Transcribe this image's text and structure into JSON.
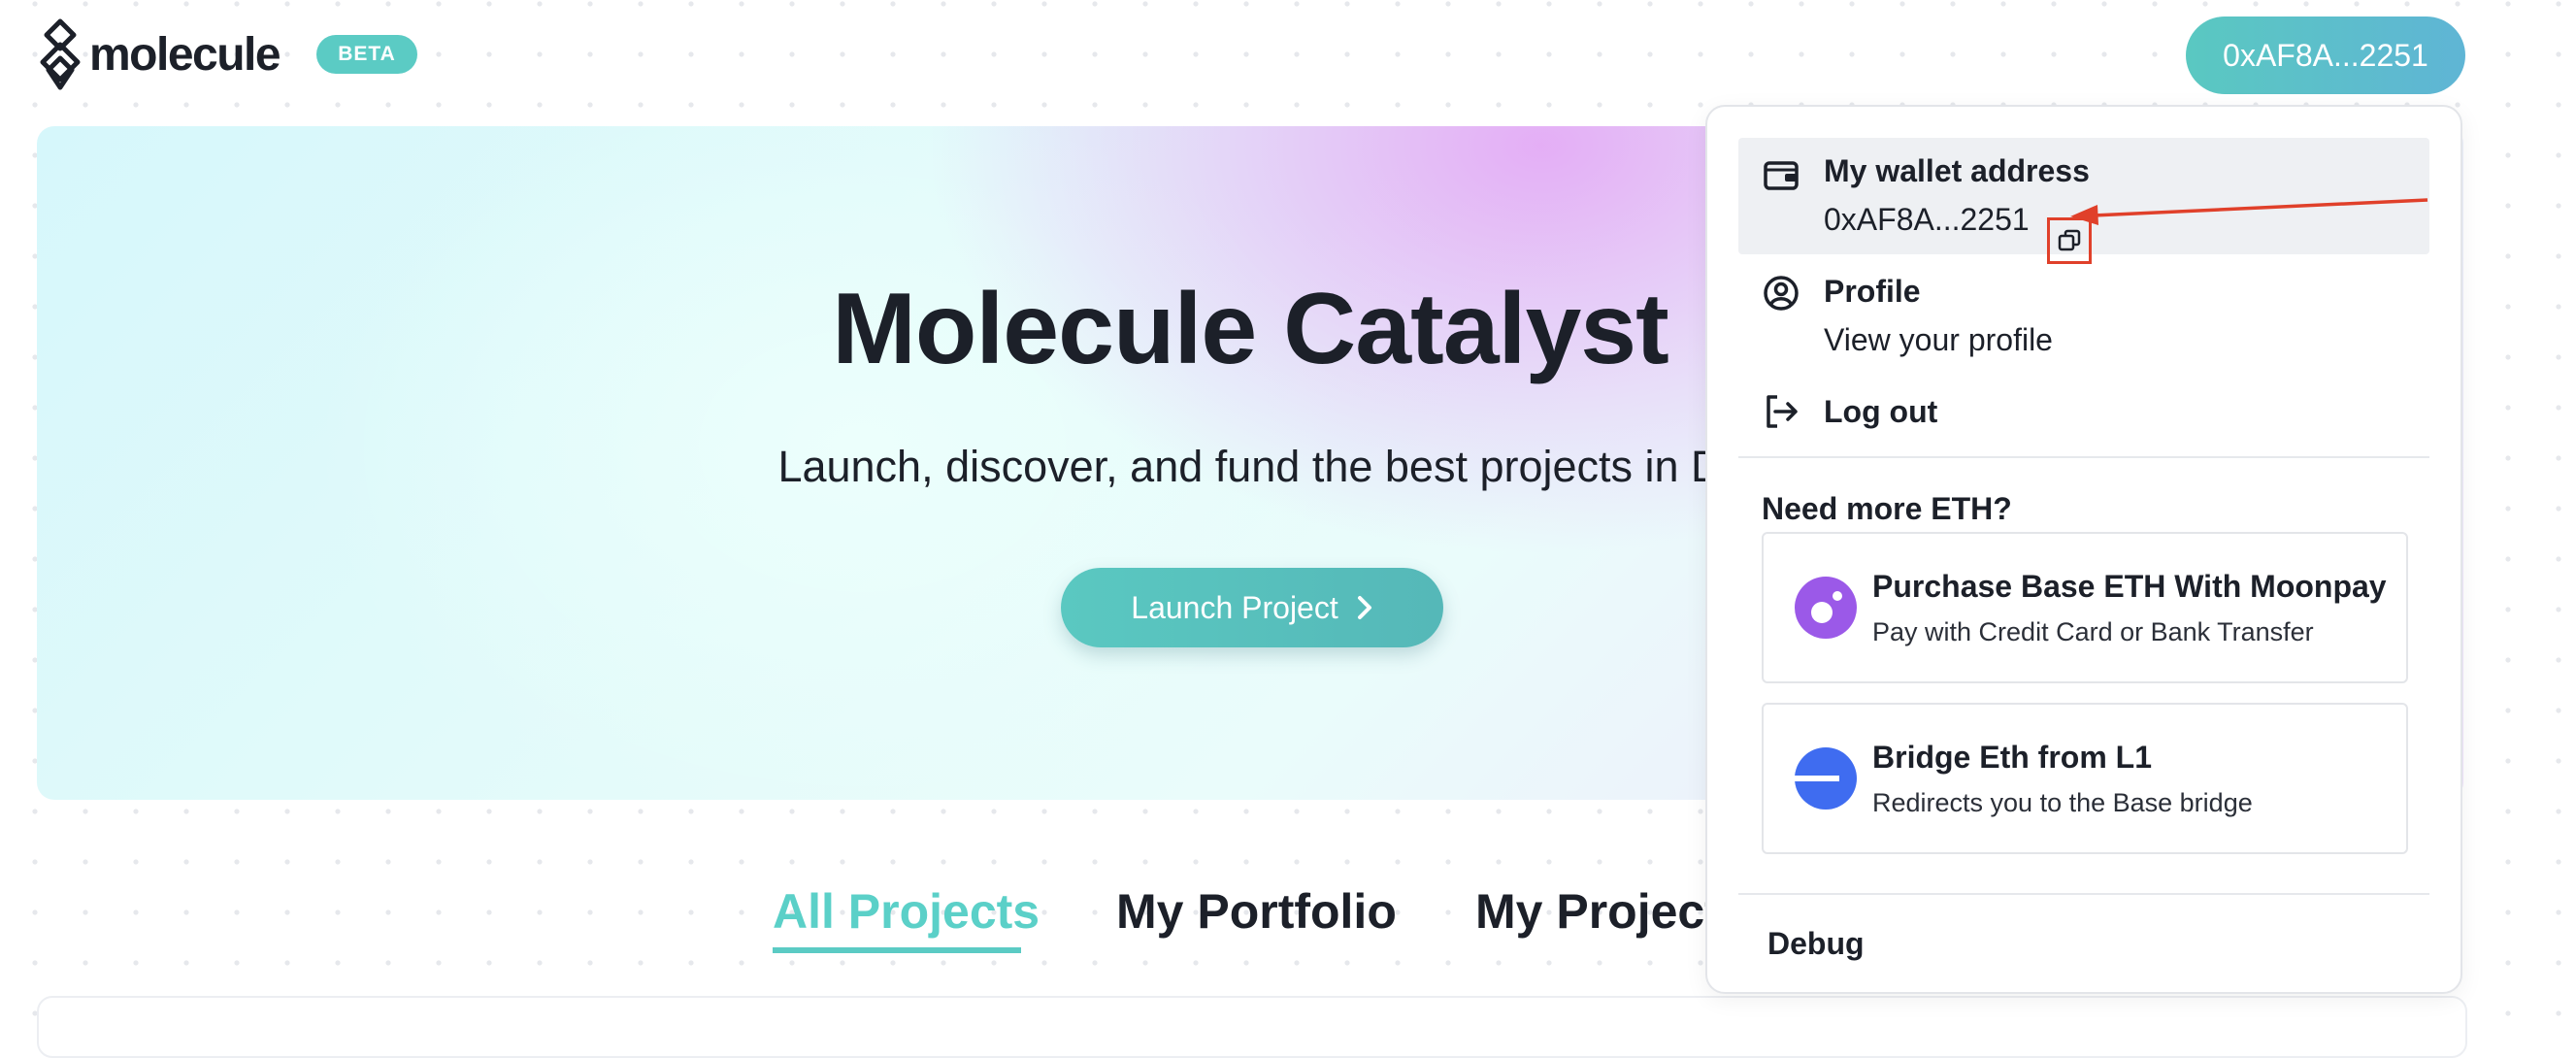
{
  "header": {
    "logo_text": "molecule",
    "beta_badge": "BETA",
    "wallet_button": "0xAF8A...2251"
  },
  "hero": {
    "title": "Molecule Catalyst",
    "subtitle": "Launch, discover, and fund the best projects in D",
    "launch_button": "Launch Project"
  },
  "tabs": [
    {
      "label": "All Projects",
      "active": true
    },
    {
      "label": "My Portfolio",
      "active": false
    },
    {
      "label": "My Project",
      "active": false
    }
  ],
  "dropdown": {
    "wallet": {
      "title": "My wallet address",
      "address": "0xAF8A...2251"
    },
    "profile": {
      "title": "Profile",
      "subtitle": "View your profile"
    },
    "logout": {
      "title": "Log out"
    },
    "eth_heading": "Need more ETH?",
    "options": [
      {
        "title": "Purchase Base ETH With Moonpay",
        "subtitle": "Pay with Credit Card or Bank Transfer",
        "icon": "moonpay-icon"
      },
      {
        "title": "Bridge Eth from L1",
        "subtitle": "Redirects you to the Base bridge",
        "icon": "base-bridge-icon"
      }
    ],
    "debug": "Debug"
  },
  "colors": {
    "accent": "#5bcbc4",
    "annotation": "#e0402a",
    "moonpay": "#9b59e8",
    "base": "#3f6cf0"
  }
}
